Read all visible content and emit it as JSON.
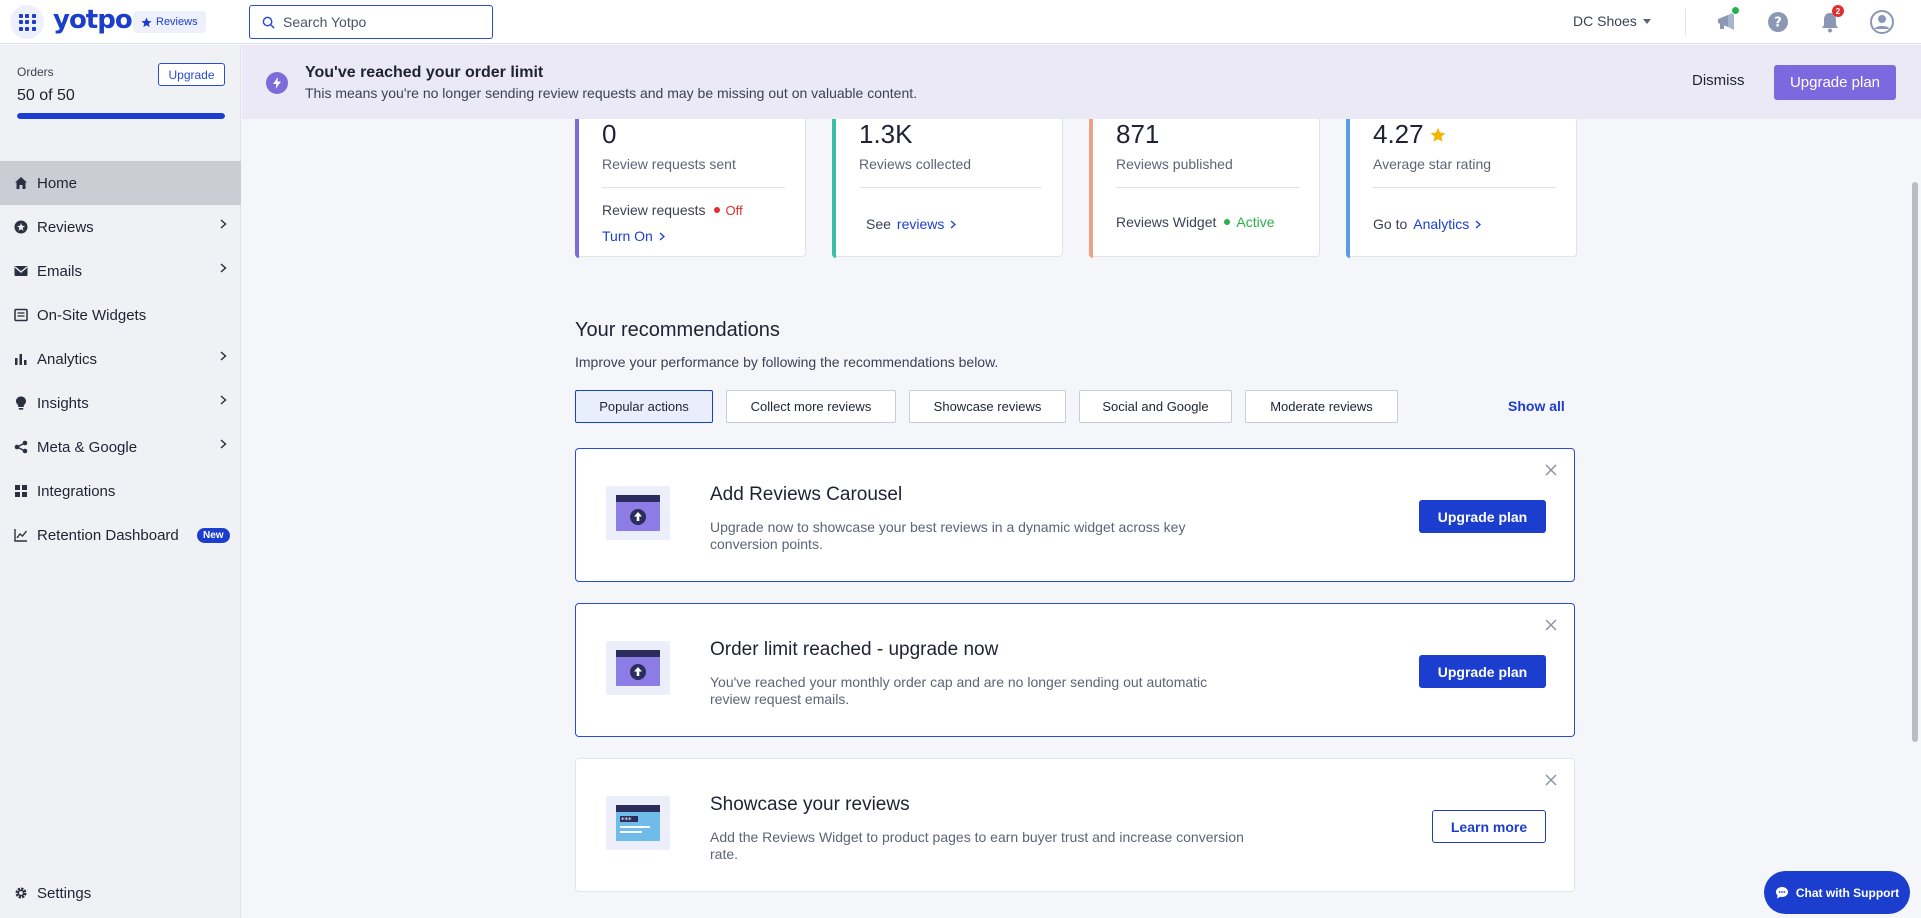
{
  "topbar": {
    "logo": "yotpo.",
    "product_chip": "Reviews",
    "search_placeholder": "Search Yotpo",
    "store_name": "DC Shoes",
    "notifications_count": "2"
  },
  "sidebar": {
    "orders_label": "Orders",
    "orders_value": "50 of 50",
    "orders_progress_fraction": 1.0,
    "upgrade_label": "Upgrade",
    "items": [
      {
        "label": "Home",
        "icon": "home-icon",
        "active": true
      },
      {
        "label": "Reviews",
        "icon": "star-circle-icon",
        "chevron": true
      },
      {
        "label": "Emails",
        "icon": "mail-icon",
        "chevron": true
      },
      {
        "label": "On-Site Widgets",
        "icon": "widget-icon"
      },
      {
        "label": "Analytics",
        "icon": "bar-chart-icon",
        "chevron": true
      },
      {
        "label": "Insights",
        "icon": "lightbulb-icon",
        "chevron": true
      },
      {
        "label": "Meta & Google",
        "icon": "share-icon",
        "chevron": true
      },
      {
        "label": "Integrations",
        "icon": "grid-icon"
      },
      {
        "label": "Retention Dashboard",
        "icon": "trend-icon",
        "badge": "New"
      }
    ],
    "settings_label": "Settings"
  },
  "banner": {
    "title": "You've reached your order limit",
    "subtitle": "This means you're no longer sending review requests and may be missing out on valuable content.",
    "dismiss_label": "Dismiss",
    "upgrade_label": "Upgrade plan"
  },
  "stats": [
    {
      "value": "0",
      "label": "Review requests sent",
      "line1_text": "Review requests",
      "line1_status": "Off",
      "line2_link": "Turn On"
    },
    {
      "value": "1.3K",
      "label": "Reviews collected",
      "line_prefix": "See",
      "line_link": "reviews"
    },
    {
      "value": "871",
      "label": "Reviews published",
      "line_text": "Reviews Widget",
      "line_status": "Active"
    },
    {
      "value": "4.27",
      "label": "Average star rating",
      "line_prefix": "Go to",
      "line_link": "Analytics"
    }
  ],
  "recommendations": {
    "title": "Your recommendations",
    "subtitle": "Improve your performance by following the recommendations below.",
    "filters": [
      "Popular actions",
      "Collect more reviews",
      "Showcase reviews",
      "Social and Google",
      "Moderate reviews"
    ],
    "show_all": "Show all",
    "cards": [
      {
        "title": "Add Reviews Carousel",
        "description": "Upgrade now to showcase your best reviews in a dynamic widget across key conversion points.",
        "button": "Upgrade plan"
      },
      {
        "title": "Order limit reached - upgrade now",
        "description": "You've reached your monthly order cap and are no longer sending out automatic review request emails.",
        "button": "Upgrade plan"
      },
      {
        "title": "Showcase your reviews",
        "description": "Add the Reviews Widget to product pages to earn buyer trust and increase conversion rate.",
        "button": "Learn more"
      }
    ]
  },
  "chat": {
    "label": "Chat with Support"
  },
  "colors": {
    "brand": "#1c3ecf",
    "banner_bg": "#ece9f7",
    "upgrade_purple": "#7c68df",
    "off_red": "#e02f2f",
    "active_green": "#27b14a",
    "star_gold": "#f4b400"
  }
}
